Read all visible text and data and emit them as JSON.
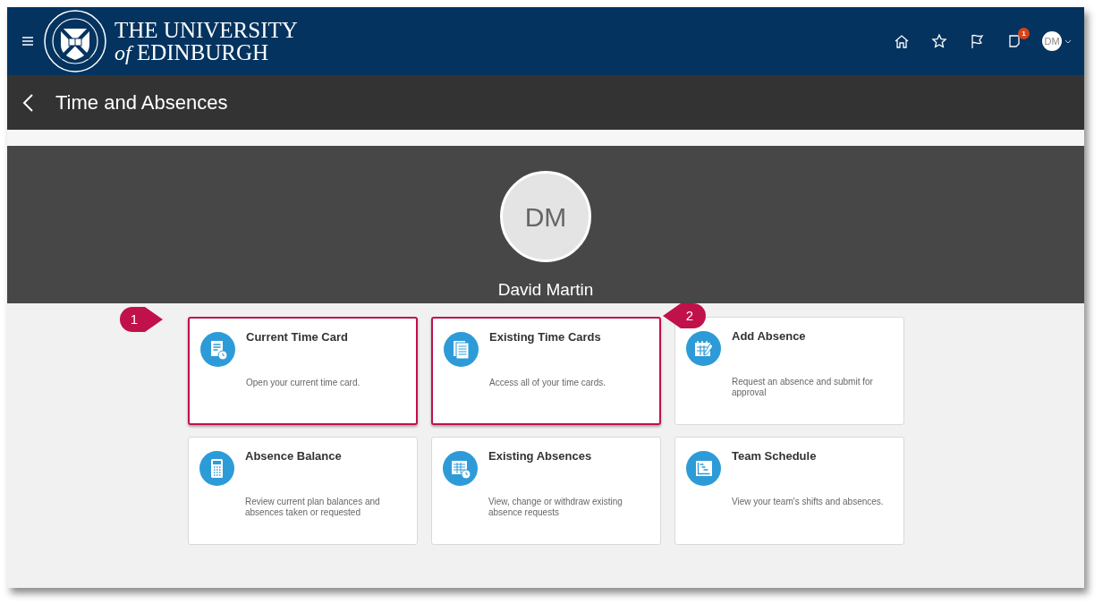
{
  "header": {
    "brand_line1": "THE UNIVERSITY",
    "brand_prefix": "of",
    "brand_line2": "EDINBURGH",
    "notification_count": "1",
    "avatar_initials": "DM"
  },
  "page_title": "Time and Absences",
  "profile": {
    "initials": "DM",
    "name": "David Martin"
  },
  "cards": [
    {
      "title": "Current Time Card",
      "description": "Open your current time card.",
      "highlighted": true,
      "callout": "1"
    },
    {
      "title": "Existing Time Cards",
      "description": "Access all of your time cards.",
      "highlighted": true,
      "callout": "2"
    },
    {
      "title": "Add Absence",
      "description": "Request an absence and submit for approval",
      "highlighted": false
    },
    {
      "title": "Absence Balance",
      "description": "Review current plan balances and absences taken or requested",
      "highlighted": false
    },
    {
      "title": "Existing Absences",
      "description": "View, change or withdraw existing absence requests",
      "highlighted": false
    },
    {
      "title": "Team Schedule",
      "description": "View your team's shifts and absences.",
      "highlighted": false
    }
  ]
}
